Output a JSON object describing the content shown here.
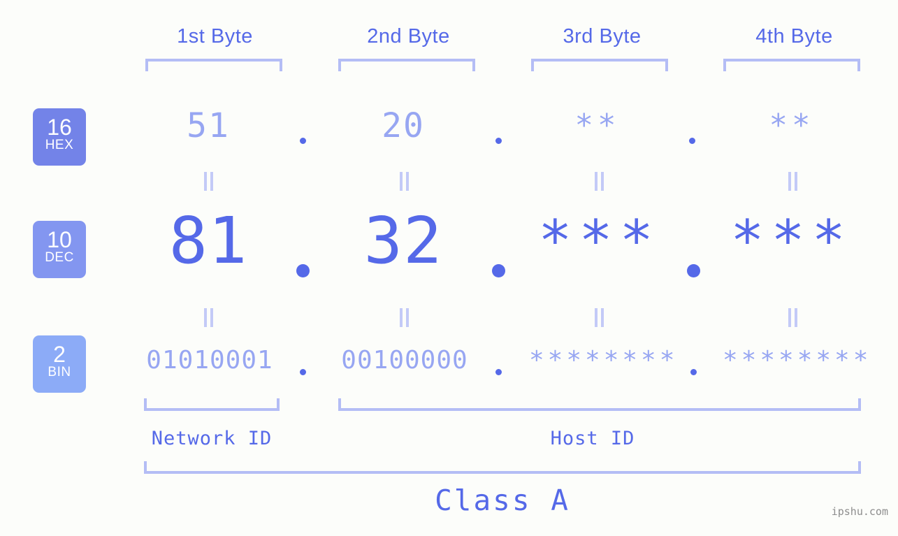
{
  "page": {
    "background": "#fcfdfa",
    "accent": "#5569e8",
    "accent_light": "#97a6f2",
    "bracket_color": "#b4bdf5",
    "watermark": "ipshu.com"
  },
  "byte_headers": [
    {
      "label": "1st Byte"
    },
    {
      "label": "2nd Byte"
    },
    {
      "label": "3rd Byte"
    },
    {
      "label": "4th Byte"
    }
  ],
  "bases": [
    {
      "number": "16",
      "name": "HEX",
      "color": "#7383e8"
    },
    {
      "number": "10",
      "name": "DEC",
      "color": "#8396f0"
    },
    {
      "number": "2",
      "name": "BIN",
      "color": "#8cabf7"
    }
  ],
  "rows": {
    "hex": {
      "values": [
        "51",
        "20",
        "**",
        "**"
      ]
    },
    "dec": {
      "values": [
        "81",
        "32",
        "***",
        "***"
      ]
    },
    "bin": {
      "values": [
        "01010001",
        "00100000",
        "********",
        "********"
      ]
    }
  },
  "separator": ".",
  "equals_mark": "||",
  "sections": [
    {
      "label": "Network ID"
    },
    {
      "label": "Host ID"
    }
  ],
  "class": {
    "label": "Class A"
  }
}
